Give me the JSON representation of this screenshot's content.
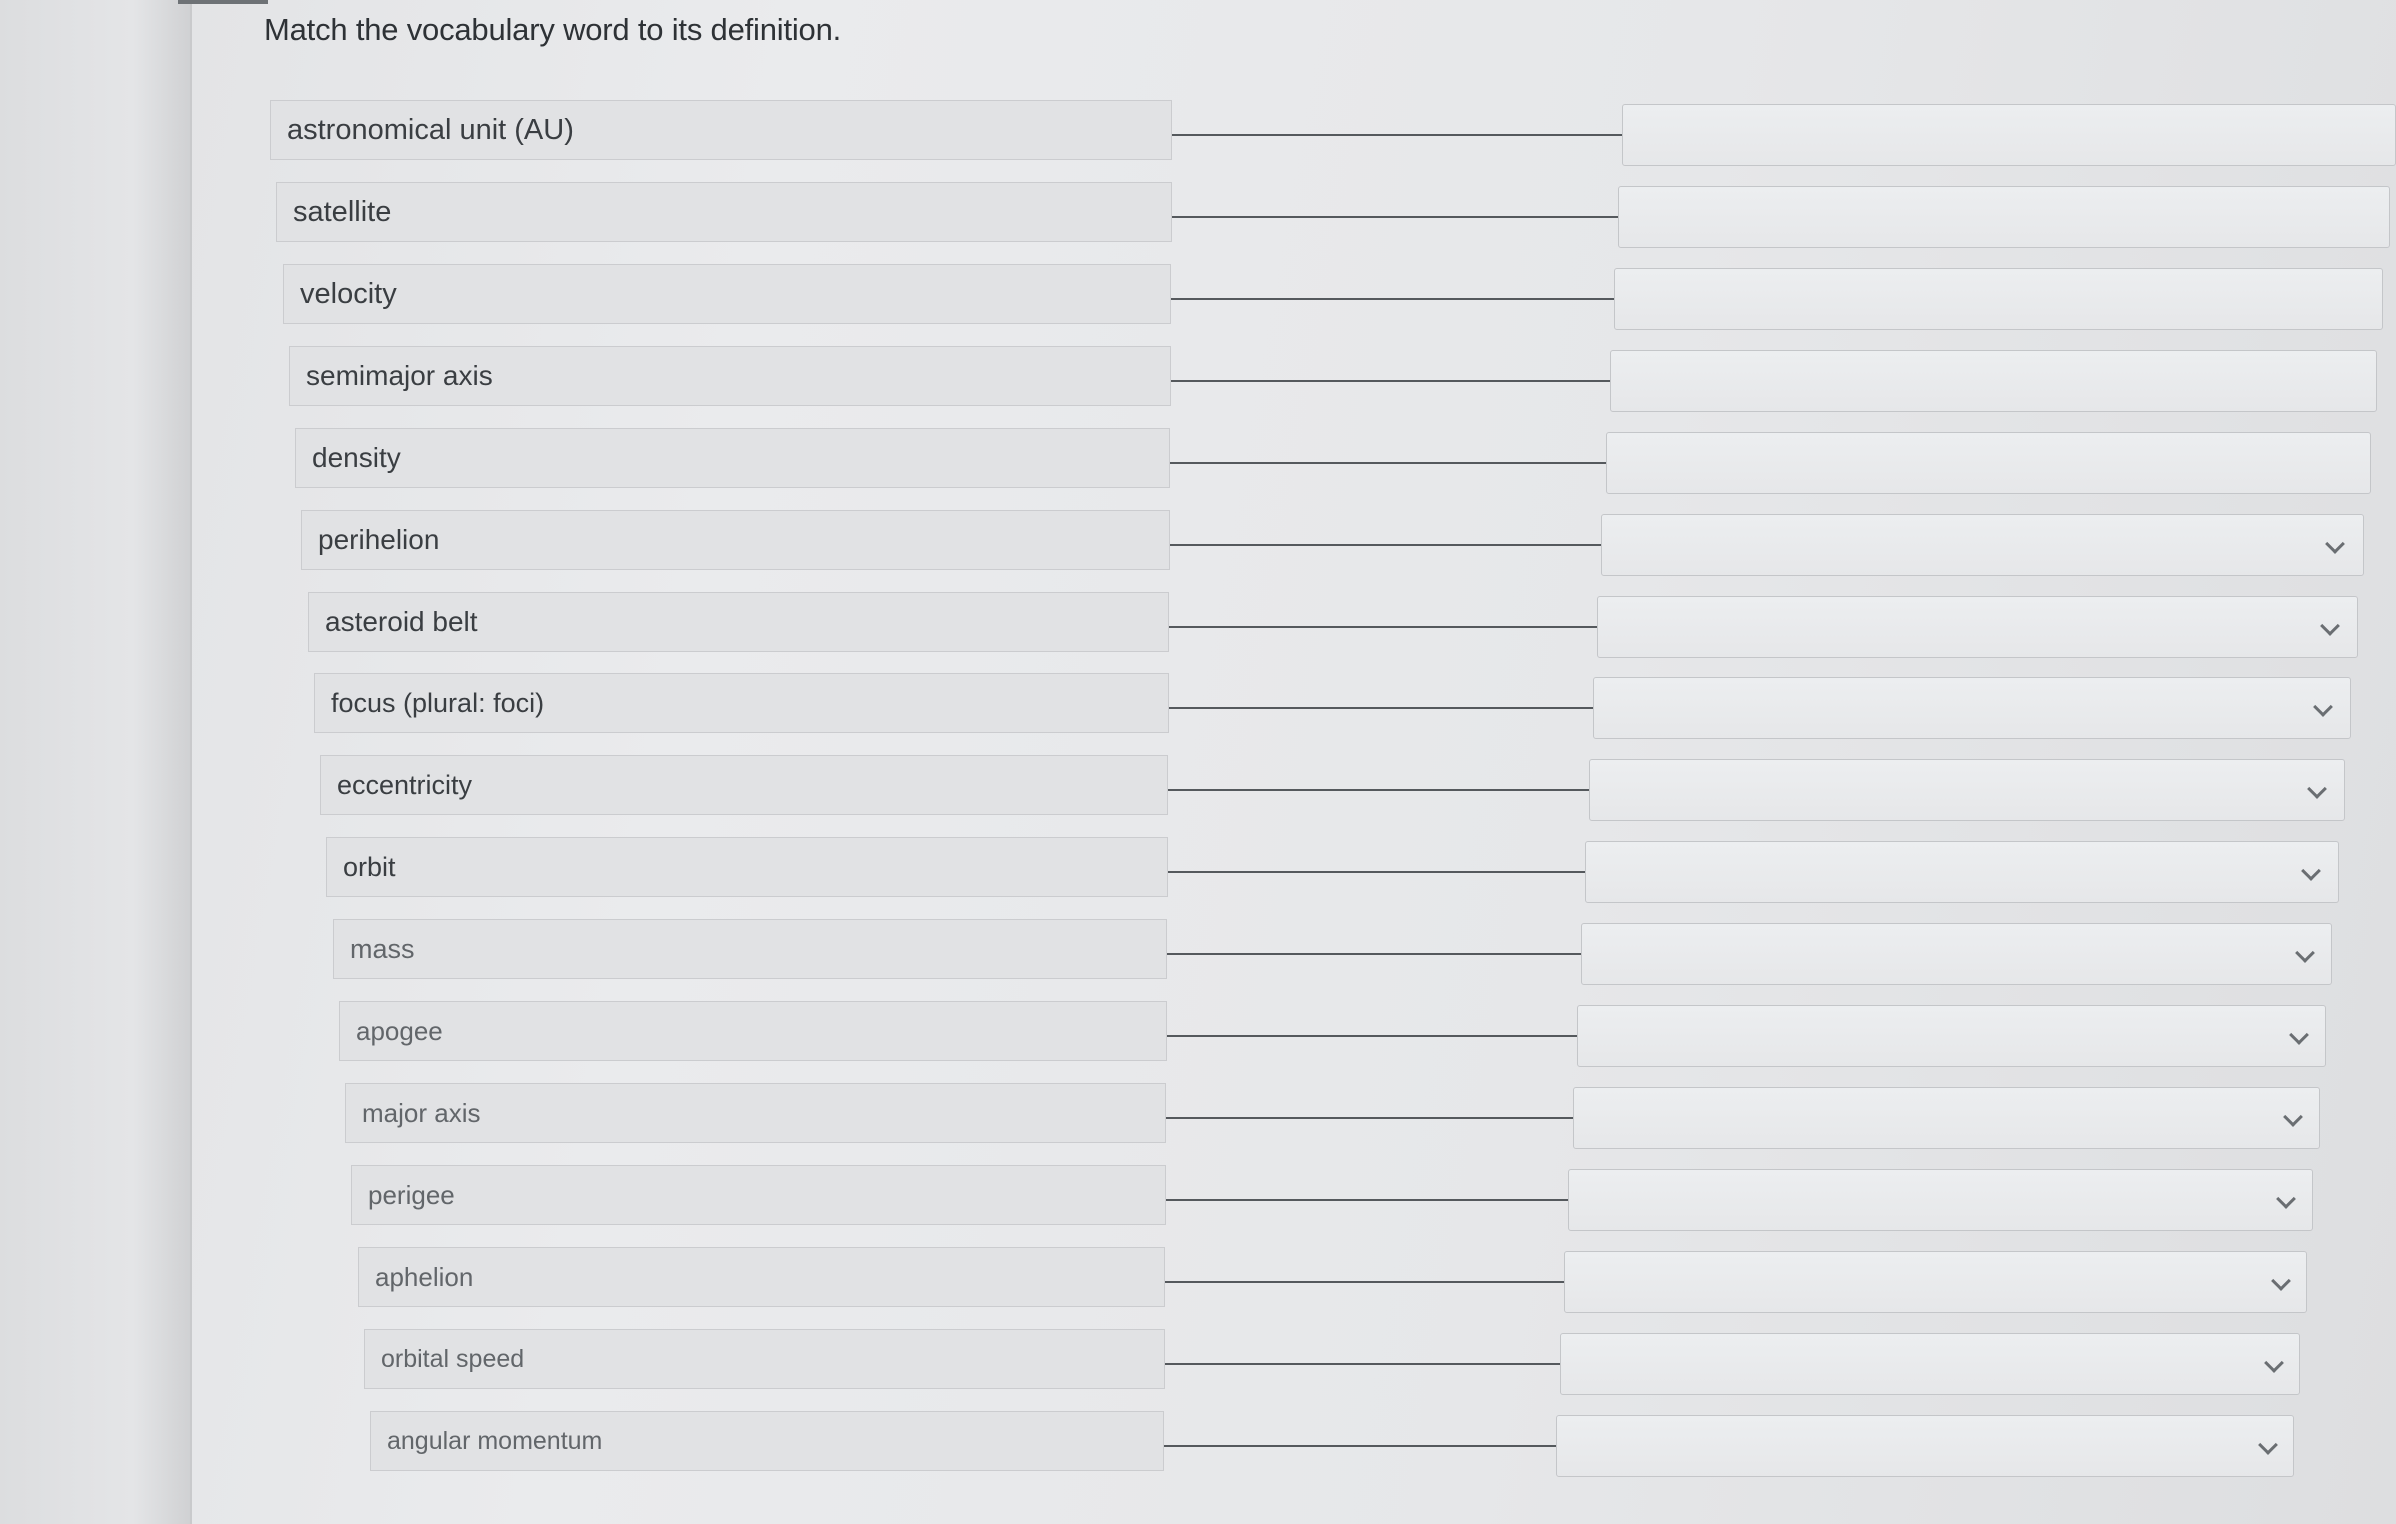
{
  "instructions": "Match the vocabulary word to its definition.",
  "icons": {
    "dropdown": "chevron-down-icon"
  },
  "terms": [
    {
      "label": "astronomical unit (AU)"
    },
    {
      "label": "satellite"
    },
    {
      "label": "velocity"
    },
    {
      "label": "semimajor axis"
    },
    {
      "label": "density"
    },
    {
      "label": "perihelion"
    },
    {
      "label": "asteroid belt"
    },
    {
      "label": "focus (plural: foci)"
    },
    {
      "label": "eccentricity"
    },
    {
      "label": "orbit"
    },
    {
      "label": "mass"
    },
    {
      "label": "apogee"
    },
    {
      "label": "major axis"
    },
    {
      "label": "perigee"
    },
    {
      "label": "aphelion"
    },
    {
      "label": "orbital speed"
    },
    {
      "label": "angular momentum"
    }
  ]
}
